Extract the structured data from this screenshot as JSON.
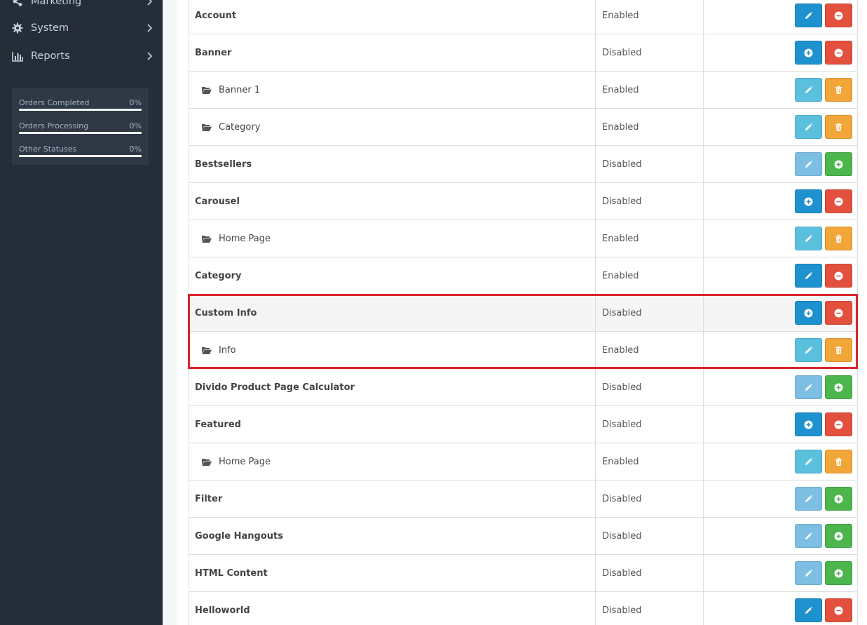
{
  "sidebar": {
    "nav": [
      {
        "label": "Marketing",
        "icon": "share-icon"
      },
      {
        "label": "System",
        "icon": "gear-icon"
      },
      {
        "label": "Reports",
        "icon": "bar-chart-icon"
      }
    ],
    "stats": [
      {
        "label": "Orders Completed",
        "percent": "0%"
      },
      {
        "label": "Orders Processing",
        "percent": "0%"
      },
      {
        "label": "Other Statuses",
        "percent": "0%"
      }
    ]
  },
  "colors": {
    "sidebar_bg": "#252d38",
    "primary": "#1e91cf",
    "danger": "#e3503e",
    "info": "#5bc0de",
    "warning": "#f3a638",
    "success": "#4cb64c",
    "highlight": "#d9262c"
  },
  "modules": [
    {
      "name": "Account",
      "level": "parent",
      "status": "Enabled",
      "actions": [
        "edit-primary",
        "uninstall"
      ]
    },
    {
      "name": "Banner",
      "level": "parent",
      "status": "Disabled",
      "actions": [
        "add-primary",
        "uninstall"
      ]
    },
    {
      "name": "Banner 1",
      "level": "child",
      "status": "Enabled",
      "actions": [
        "edit-info",
        "delete"
      ]
    },
    {
      "name": "Category",
      "level": "child",
      "status": "Enabled",
      "actions": [
        "edit-info",
        "delete"
      ]
    },
    {
      "name": "Bestsellers",
      "level": "parent",
      "status": "Disabled",
      "actions": [
        "edit-disabled",
        "install"
      ]
    },
    {
      "name": "Carousel",
      "level": "parent",
      "status": "Disabled",
      "actions": [
        "add-primary",
        "uninstall"
      ]
    },
    {
      "name": "Home Page",
      "level": "child",
      "status": "Enabled",
      "actions": [
        "edit-info",
        "delete"
      ]
    },
    {
      "name": "Category",
      "level": "parent",
      "status": "Enabled",
      "actions": [
        "edit-primary",
        "uninstall"
      ]
    },
    {
      "name": "Custom Info",
      "level": "parent",
      "status": "Disabled",
      "actions": [
        "add-primary",
        "uninstall"
      ],
      "highlight": true
    },
    {
      "name": "Info",
      "level": "child",
      "status": "Enabled",
      "actions": [
        "edit-info",
        "delete"
      ]
    },
    {
      "name": "Divido Product Page Calculator",
      "level": "parent",
      "status": "Disabled",
      "actions": [
        "edit-disabled",
        "install"
      ]
    },
    {
      "name": "Featured",
      "level": "parent",
      "status": "Disabled",
      "actions": [
        "add-primary",
        "uninstall"
      ]
    },
    {
      "name": "Home Page",
      "level": "child",
      "status": "Enabled",
      "actions": [
        "edit-info",
        "delete"
      ]
    },
    {
      "name": "Filter",
      "level": "parent",
      "status": "Disabled",
      "actions": [
        "edit-disabled",
        "install"
      ]
    },
    {
      "name": "Google Hangouts",
      "level": "parent",
      "status": "Disabled",
      "actions": [
        "edit-disabled",
        "install"
      ]
    },
    {
      "name": "HTML Content",
      "level": "parent",
      "status": "Disabled",
      "actions": [
        "edit-disabled",
        "install"
      ]
    },
    {
      "name": "Helloworld",
      "level": "parent",
      "status": "Disabled",
      "actions": [
        "edit-primary",
        "uninstall"
      ]
    }
  ]
}
